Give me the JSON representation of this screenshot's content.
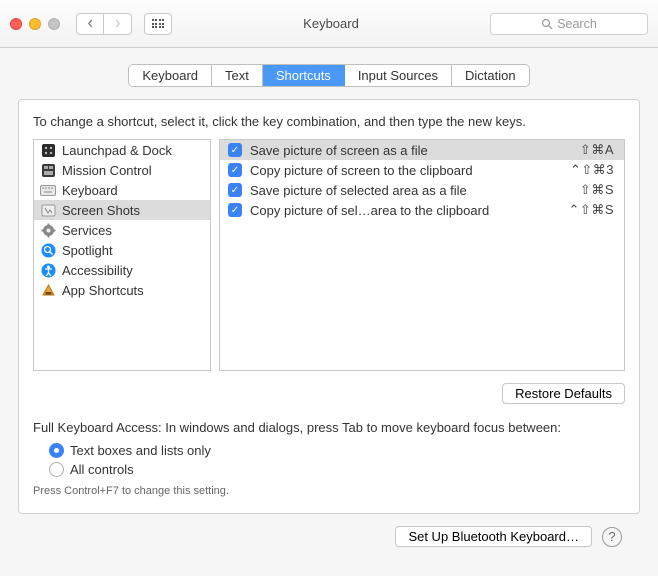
{
  "window": {
    "title": "Keyboard"
  },
  "search": {
    "placeholder": "Search"
  },
  "tabs": [
    {
      "label": "Keyboard"
    },
    {
      "label": "Text"
    },
    {
      "label": "Shortcuts"
    },
    {
      "label": "Input Sources"
    },
    {
      "label": "Dictation"
    }
  ],
  "instruction": "To change a shortcut, select it, click the key combination, and then type the new keys.",
  "categories": [
    {
      "label": "Launchpad & Dock"
    },
    {
      "label": "Mission Control"
    },
    {
      "label": "Keyboard"
    },
    {
      "label": "Screen Shots"
    },
    {
      "label": "Services"
    },
    {
      "label": "Spotlight"
    },
    {
      "label": "Accessibility"
    },
    {
      "label": "App Shortcuts"
    }
  ],
  "shortcuts": [
    {
      "name": "Save picture of screen as a file",
      "keys": "⇧⌘A"
    },
    {
      "name": "Copy picture of screen to the clipboard",
      "keys": "⌃⇧⌘3"
    },
    {
      "name": "Save picture of selected area as a file",
      "keys": "⇧⌘S"
    },
    {
      "name": "Copy picture of sel…area to the clipboard",
      "keys": "⌃⇧⌘S"
    }
  ],
  "buttons": {
    "restore": "Restore Defaults",
    "bluetooth": "Set Up Bluetooth Keyboard…"
  },
  "kba": {
    "label": "Full Keyboard Access: In windows and dialogs, press Tab to move keyboard focus between:",
    "opt1": "Text boxes and lists only",
    "opt2": "All controls",
    "hint": "Press Control+F7 to change this setting."
  }
}
